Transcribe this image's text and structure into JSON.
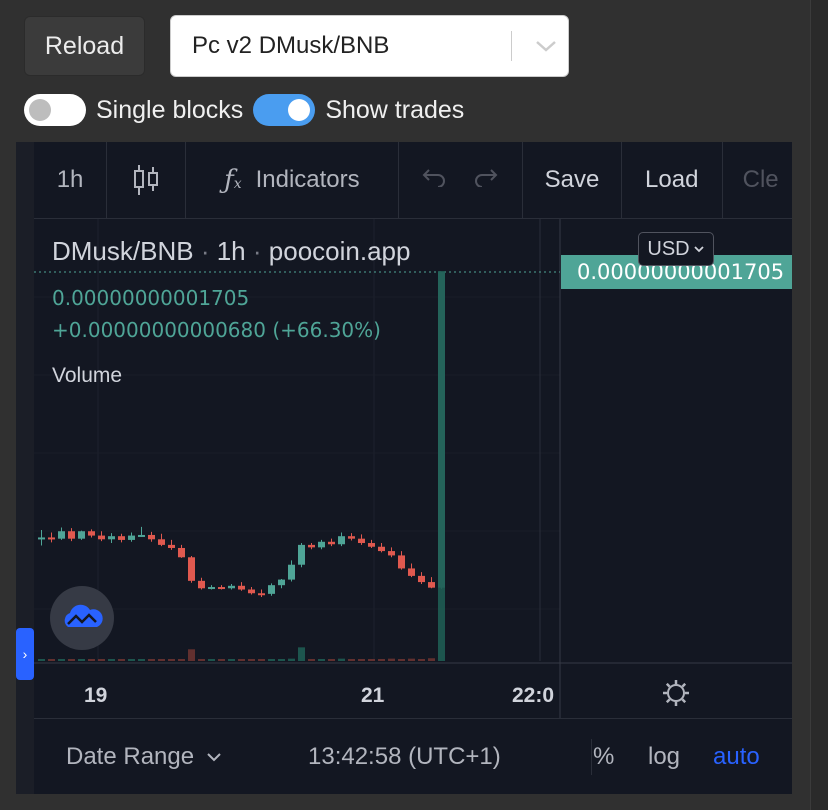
{
  "controls": {
    "reload_label": "Reload",
    "pair_value": "Pc v2 DMusk/BNB",
    "single_blocks_label": "Single blocks",
    "single_blocks_on": false,
    "show_trades_label": "Show trades",
    "show_trades_on": true
  },
  "toolbar": {
    "interval": "1h",
    "candles_icon": "candlestick-icon",
    "indicators_label": "Indicators",
    "undo_icon": "undo-icon",
    "redo_icon": "redo-icon",
    "save_label": "Save",
    "load_label": "Load",
    "clear_label": "Cle"
  },
  "legend": {
    "symbol": "DMusk/BNB",
    "interval": "1h",
    "source": "poocoin.app",
    "price": "0.00000000001705",
    "change": "+0.00000000000680 (+66.30%)",
    "volume_label": "Volume"
  },
  "price_scale": {
    "currency": "USD",
    "last_price_label": "0.00000000001705"
  },
  "time_axis": {
    "labels": [
      "19",
      "21",
      "22:0"
    ]
  },
  "bottom_bar": {
    "date_range_label": "Date Range",
    "clock": "13:42:58 (UTC+1)",
    "percent_label": "%",
    "log_label": "log",
    "auto_label": "auto"
  },
  "colors": {
    "up": "#4fa597",
    "down": "#e0594f",
    "accent": "#2962ff",
    "auto_active": "#2962ff"
  },
  "chart_data": {
    "type": "candlestick",
    "symbol": "DMusk/BNB",
    "interval": "1h",
    "last_price": 1.705e-11,
    "change_abs": 6.8e-12,
    "change_pct": 66.3,
    "x_tick_labels": [
      "19",
      "21",
      "22:0"
    ],
    "note_series": "relative candle OHLC (0=low of visible range, 100=last price)",
    "candles": [
      {
        "o": 3.5,
        "h": 5,
        "l": 2.5,
        "c": 3.8
      },
      {
        "o": 3.8,
        "h": 4.6,
        "l": 3,
        "c": 3.6
      },
      {
        "o": 3.6,
        "h": 5.4,
        "l": 3.4,
        "c": 4.8
      },
      {
        "o": 4.8,
        "h": 5.3,
        "l": 3.2,
        "c": 3.6
      },
      {
        "o": 3.6,
        "h": 4.9,
        "l": 3.4,
        "c": 4.8
      },
      {
        "o": 4.8,
        "h": 5.1,
        "l": 3.8,
        "c": 4.1
      },
      {
        "o": 4.1,
        "h": 4.8,
        "l": 3.2,
        "c": 3.5
      },
      {
        "o": 3.5,
        "h": 4.5,
        "l": 2.9,
        "c": 4.0
      },
      {
        "o": 4.0,
        "h": 4.4,
        "l": 3.0,
        "c": 3.4
      },
      {
        "o": 3.4,
        "h": 4.6,
        "l": 3.1,
        "c": 4.1
      },
      {
        "o": 4.1,
        "h": 5.5,
        "l": 3.9,
        "c": 4.2
      },
      {
        "o": 4.2,
        "h": 4.7,
        "l": 3.1,
        "c": 3.5
      },
      {
        "o": 3.5,
        "h": 4.4,
        "l": 2.4,
        "c": 2.6
      },
      {
        "o": 2.6,
        "h": 3.4,
        "l": 1.8,
        "c": 2.1
      },
      {
        "o": 2.1,
        "h": 2.6,
        "l": 0.5,
        "c": 0.6
      },
      {
        "o": 0.6,
        "h": 0.8,
        "l": -3.5,
        "c": -3.2
      },
      {
        "o": -3.2,
        "h": -2.7,
        "l": -4.6,
        "c": -4.4
      },
      {
        "o": -4.4,
        "h": -3.9,
        "l": -4.6,
        "c": -4.2
      },
      {
        "o": -4.2,
        "h": -3.9,
        "l": -4.6,
        "c": -4.4
      },
      {
        "o": -4.4,
        "h": -3.7,
        "l": -4.6,
        "c": -4.0
      },
      {
        "o": -4.0,
        "h": -3.4,
        "l": -4.8,
        "c": -4.6
      },
      {
        "o": -4.6,
        "h": -4.2,
        "l": -5.4,
        "c": -5.2
      },
      {
        "o": -5.2,
        "h": -4.6,
        "l": -5.8,
        "c": -5.3
      },
      {
        "o": -5.3,
        "h": -3.6,
        "l": -5.6,
        "c": -3.9
      },
      {
        "o": -3.9,
        "h": -2.9,
        "l": -4.4,
        "c": -3.0
      },
      {
        "o": -3.0,
        "h": 0.1,
        "l": -3.3,
        "c": -0.6
      },
      {
        "o": -0.6,
        "h": 2.9,
        "l": -1.0,
        "c": 2.6
      },
      {
        "o": 2.6,
        "h": 2.9,
        "l": 1.9,
        "c": 2.2
      },
      {
        "o": 2.2,
        "h": 3.4,
        "l": 1.9,
        "c": 3.1
      },
      {
        "o": 3.1,
        "h": 3.6,
        "l": 2.4,
        "c": 2.7
      },
      {
        "o": 2.7,
        "h": 4.6,
        "l": 2.4,
        "c": 4.0
      },
      {
        "o": 4.0,
        "h": 4.5,
        "l": 3.3,
        "c": 3.6
      },
      {
        "o": 3.6,
        "h": 4.3,
        "l": 2.6,
        "c": 2.9
      },
      {
        "o": 2.9,
        "h": 3.4,
        "l": 2.1,
        "c": 2.3
      },
      {
        "o": 2.3,
        "h": 2.9,
        "l": 1.4,
        "c": 1.6
      },
      {
        "o": 1.6,
        "h": 2.2,
        "l": 0.6,
        "c": 0.9
      },
      {
        "o": 0.9,
        "h": 1.6,
        "l": -1.4,
        "c": -1.2
      },
      {
        "o": -1.2,
        "h": -0.4,
        "l": -2.6,
        "c": -2.4
      },
      {
        "o": -2.4,
        "h": -1.8,
        "l": -3.7,
        "c": -3.4
      },
      {
        "o": -3.4,
        "h": -2.6,
        "l": -4.4,
        "c": -4.3
      },
      {
        "o": -4.3,
        "h": 100,
        "l": -4.5,
        "c": 100
      }
    ],
    "volume": [
      0.5,
      0.3,
      0.4,
      0.3,
      0.2,
      0.3,
      0.4,
      0.3,
      0.3,
      0.2,
      0.3,
      0.2,
      0.5,
      0.3,
      0.4,
      3.0,
      0.5,
      0.4,
      0.3,
      0.3,
      0.4,
      0.4,
      0.3,
      0.5,
      0.4,
      0.6,
      3.5,
      0.5,
      0.4,
      0.3,
      0.6,
      0.4,
      0.5,
      0.4,
      0.5,
      0.6,
      0.4,
      0.6,
      0.5,
      0.7,
      100
    ]
  }
}
